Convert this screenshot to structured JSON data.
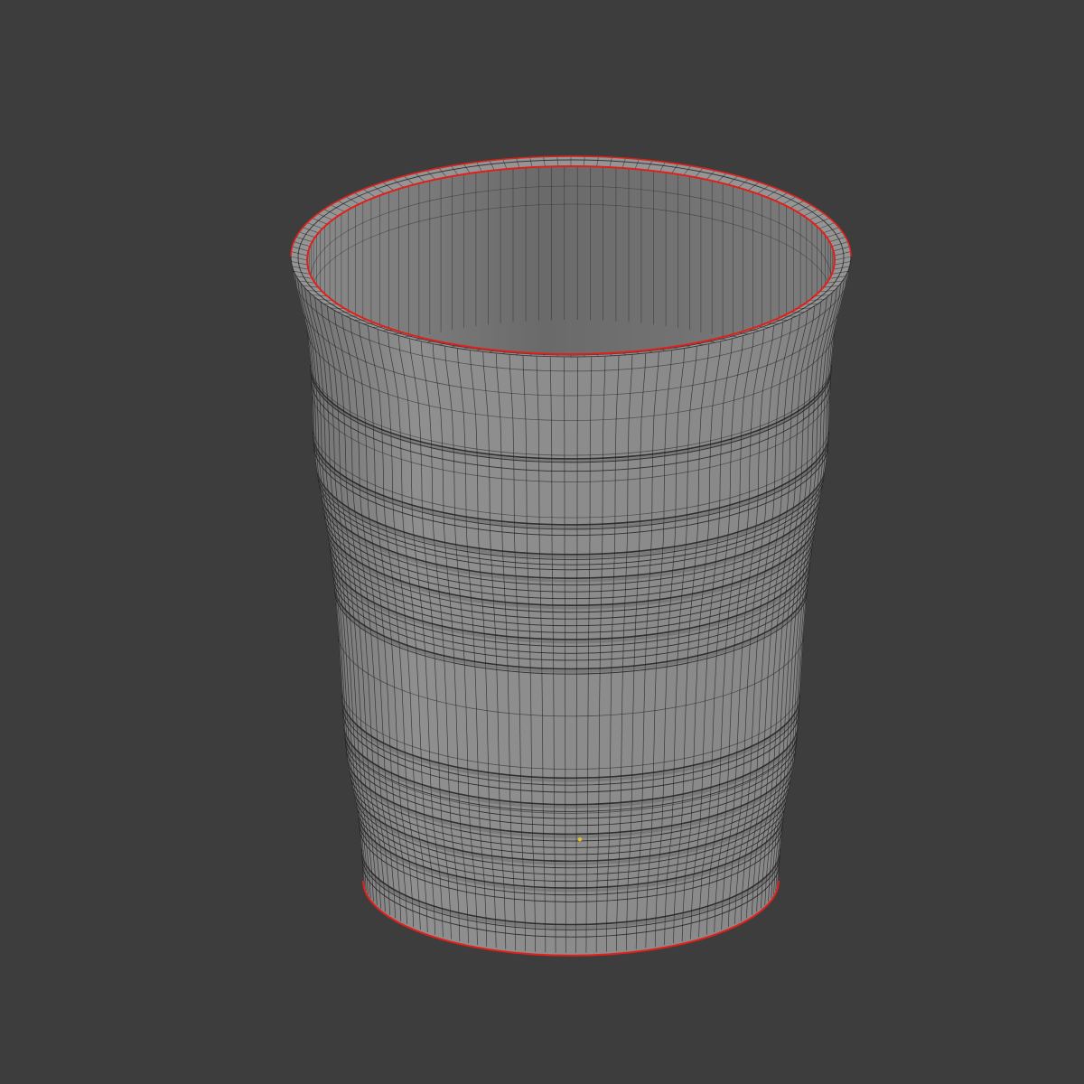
{
  "viewport": {
    "background_color": "#3d3d3d",
    "mode": "edit-mode-wireframe-overlay"
  },
  "object": {
    "shape": "cup",
    "surface_color": "#8a8a8a",
    "interior_color": "#6f6f6f",
    "wire_color": "#1e1e1e",
    "seam_color": "#e0201a",
    "vertex_marker_color": "#e8c020",
    "vertical_edge_loops": 64,
    "groove_bands": 6
  }
}
